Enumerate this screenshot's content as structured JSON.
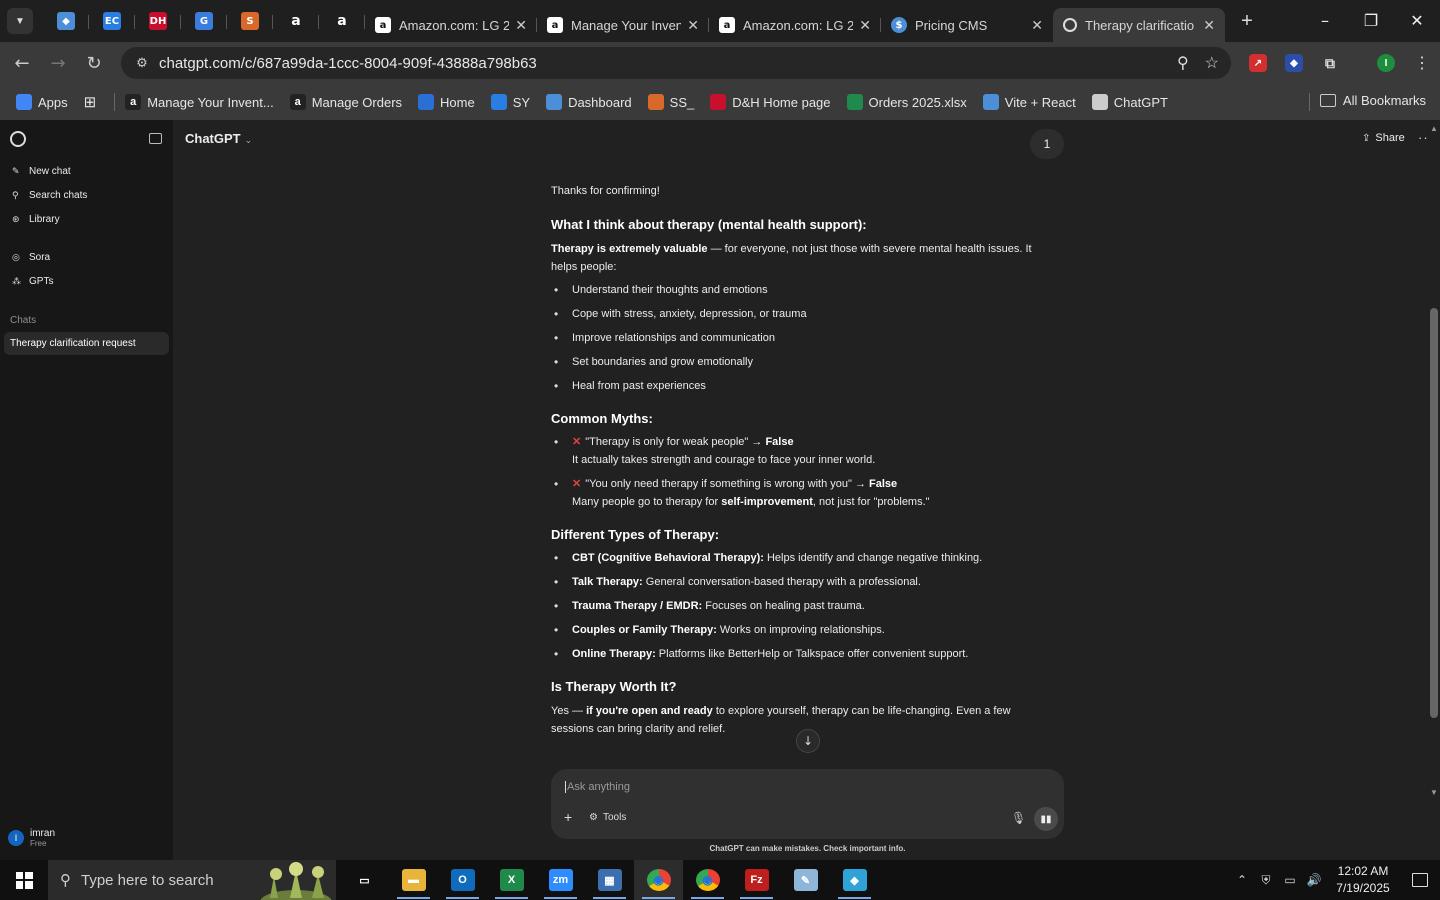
{
  "browser": {
    "pinned_tabs": [
      {
        "icon": "tab-icon-blue-diamond",
        "color": "#4d8fd6",
        "glyph": "◆"
      },
      {
        "icon": "tab-icon-ec",
        "color": "#2a7de1",
        "glyph": "EC"
      },
      {
        "icon": "tab-icon-dh",
        "color": "#c8102e",
        "glyph": "DH"
      },
      {
        "icon": "tab-icon-blue-doc",
        "color": "#3b7ddd",
        "glyph": "G"
      },
      {
        "icon": "tab-icon-stack",
        "color": "#d9692b",
        "glyph": "S"
      },
      {
        "icon": "tab-icon-amazon",
        "color": "#ffffff",
        "glyph": "a"
      },
      {
        "icon": "tab-icon-amazon",
        "color": "#ffffff",
        "glyph": "a"
      }
    ],
    "tabs": [
      {
        "label": "Amazon.com: LG 2...",
        "icon": "amazon-icon",
        "active": false
      },
      {
        "label": "Manage Your Inven...",
        "icon": "amazon-icon",
        "active": false
      },
      {
        "label": "Amazon.com: LG 2...",
        "icon": "amazon-icon",
        "active": false
      },
      {
        "label": "Pricing CMS",
        "icon": "dollar-icon",
        "active": false
      },
      {
        "label": "Therapy clarificatio",
        "icon": "chatgpt-icon",
        "active": true
      }
    ],
    "url": "chatgpt.com/c/687a99da-1ccc-8004-909f-43888a798b63",
    "bookmarks": [
      {
        "label": "Apps",
        "color": "#4285f4"
      },
      {
        "label": "Manage Your Invent...",
        "color": "#ffffff"
      },
      {
        "label": "Manage Orders",
        "color": "#ffffff"
      },
      {
        "label": "Home",
        "color": "#2a6fd6"
      },
      {
        "label": "SY",
        "color": "#2a7de1"
      },
      {
        "label": "Dashboard",
        "color": "#4d8fd6"
      },
      {
        "label": "SS_",
        "color": "#d9692b"
      },
      {
        "label": "D&H Home page",
        "color": "#c8102e"
      },
      {
        "label": "Orders 2025.xlsx",
        "color": "#1f8a4c"
      },
      {
        "label": "Vite + React",
        "color": "#4d8fd6"
      },
      {
        "label": "ChatGPT",
        "color": "#cccccc"
      }
    ],
    "all_bookmarks": "All Bookmarks",
    "profile_initial": "I"
  },
  "sidebar": {
    "nav": [
      {
        "label": "New chat",
        "icon": "edit-icon"
      },
      {
        "label": "Search chats",
        "icon": "search-icon"
      },
      {
        "label": "Library",
        "icon": "library-icon"
      }
    ],
    "extras": [
      {
        "label": "Sora",
        "icon": "sora-icon"
      },
      {
        "label": "GPTs",
        "icon": "gpts-icon"
      }
    ],
    "section": "Chats",
    "chats": [
      "Therapy clarification request"
    ],
    "user": {
      "initial": "I",
      "name": "imran",
      "plan": "Free"
    }
  },
  "header": {
    "model": "ChatGPT",
    "counter": "1",
    "share": "Share"
  },
  "message": {
    "intro": "Thanks for confirming!",
    "s1_title": "What I think about therapy (mental health support):",
    "s1_lead_bold": "Therapy is extremely valuable",
    "s1_lead_rest": " — for everyone, not just those with severe mental health issues. It helps people:",
    "s1_items": [
      "Understand their thoughts and emotions",
      "Cope with stress, anxiety, depression, or trauma",
      "Improve relationships and communication",
      "Set boundaries and grow emotionally",
      "Heal from past experiences"
    ],
    "s2_title": "Common Myths:",
    "myths": [
      {
        "claim": "\"Therapy is only for weak people\" → ",
        "verdict": "False",
        "note_pre": "It actually takes strength and courage to face your inner world.",
        "note_bold": "",
        "note_post": ""
      },
      {
        "claim": "\"You only need therapy if something is wrong with you\" → ",
        "verdict": "False",
        "note_pre": "Many people go to therapy for ",
        "note_bold": "self-improvement",
        "note_post": ", not just for \"problems.\""
      }
    ],
    "s3_title": "Different Types of Therapy:",
    "types": [
      {
        "name": "CBT (Cognitive Behavioral Therapy):",
        "desc": " Helps identify and change negative thinking."
      },
      {
        "name": "Talk Therapy:",
        "desc": " General conversation-based therapy with a professional."
      },
      {
        "name": "Trauma Therapy / EMDR:",
        "desc": " Focuses on healing past trauma."
      },
      {
        "name": "Couples or Family Therapy:",
        "desc": " Works on improving relationships."
      },
      {
        "name": "Online Therapy:",
        "desc": " Platforms like BetterHelp or Talkspace offer convenient support."
      }
    ],
    "s4_title": "Is Therapy Worth It?",
    "s4_pre": "Yes — ",
    "s4_bold": "if you're open and ready",
    "s4_post": " to explore yourself, therapy can be life-changing. Even a few sessions can bring clarity and relief."
  },
  "composer": {
    "placeholder": "Ask anything",
    "tools": "Tools"
  },
  "disclaimer": "ChatGPT can make mistakes. Check important info.",
  "taskbar": {
    "search_placeholder": "Type here to search",
    "apps": [
      {
        "name": "task-view",
        "color": "#101010",
        "glyph": "▭",
        "running": false,
        "active": false
      },
      {
        "name": "file-explorer",
        "color": "#e8b43a",
        "glyph": "▬",
        "running": true,
        "active": false
      },
      {
        "name": "outlook",
        "color": "#0f6cbd",
        "glyph": "O",
        "running": true,
        "active": false
      },
      {
        "name": "excel",
        "color": "#1f8a4c",
        "glyph": "X",
        "running": true,
        "active": false
      },
      {
        "name": "zoom",
        "color": "#2d8cff",
        "glyph": "zm",
        "running": true,
        "active": false
      },
      {
        "name": "calculator",
        "color": "#3b6fb0",
        "glyph": "▦",
        "running": true,
        "active": false
      },
      {
        "name": "chrome",
        "color": "#1a73e8",
        "glyph": "◉",
        "running": true,
        "active": true
      },
      {
        "name": "chrome-2",
        "color": "#1a73e8",
        "glyph": "◉",
        "running": true,
        "active": false
      },
      {
        "name": "filezilla",
        "color": "#bf1e1e",
        "glyph": "Fz",
        "running": true,
        "active": false
      },
      {
        "name": "notepad",
        "color": "#8fb6d8",
        "glyph": "✎",
        "running": false,
        "active": false
      },
      {
        "name": "app-blue-diamond",
        "color": "#2fa3d6",
        "glyph": "◆",
        "running": true,
        "active": false
      }
    ],
    "time": "12:02 AM",
    "date": "7/19/2025"
  }
}
